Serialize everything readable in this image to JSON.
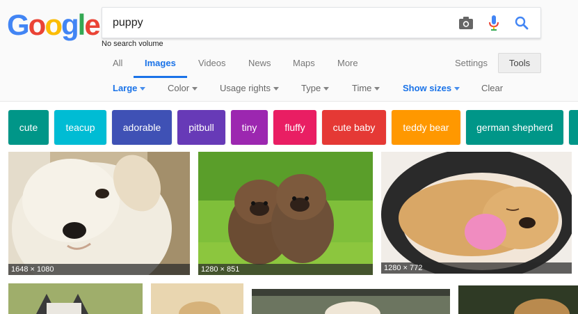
{
  "logo": {
    "letters": [
      "G",
      "o",
      "o",
      "g",
      "l",
      "e"
    ],
    "colors": [
      "#4285F4",
      "#EA4335",
      "#FBBC05",
      "#4285F4",
      "#34A853",
      "#EA4335"
    ]
  },
  "search": {
    "value": "puppy",
    "placeholder": ""
  },
  "search_meta": "No search volume",
  "tabs": [
    {
      "label": "All",
      "active": false
    },
    {
      "label": "Images",
      "active": true
    },
    {
      "label": "Videos",
      "active": false
    },
    {
      "label": "News",
      "active": false
    },
    {
      "label": "Maps",
      "active": false
    },
    {
      "label": "More",
      "active": false
    }
  ],
  "settings_label": "Settings",
  "tools_label": "Tools",
  "filters": [
    {
      "label": "Large",
      "active": true
    },
    {
      "label": "Color",
      "active": false
    },
    {
      "label": "Usage rights",
      "active": false
    },
    {
      "label": "Type",
      "active": false
    },
    {
      "label": "Time",
      "active": false
    },
    {
      "label": "Show sizes",
      "active": true
    }
  ],
  "clear_label": "Clear",
  "accent_color": "#1a73e8",
  "chips": [
    {
      "label": "cute",
      "color": "#009688"
    },
    {
      "label": "teacup",
      "color": "#00BCD4"
    },
    {
      "label": "adorable",
      "color": "#3F51B5"
    },
    {
      "label": "pitbull",
      "color": "#673AB7"
    },
    {
      "label": "tiny",
      "color": "#9C27B0"
    },
    {
      "label": "fluffy",
      "color": "#E91E63"
    },
    {
      "label": "cute baby",
      "color": "#E53935"
    },
    {
      "label": "teddy bear",
      "color": "#FF9800"
    },
    {
      "label": "german shepherd",
      "color": "#009688"
    }
  ],
  "images": [
    {
      "dimensions": "1648 × 1080"
    },
    {
      "dimensions": "1280 × 851"
    },
    {
      "dimensions": "1280 × 772"
    }
  ]
}
